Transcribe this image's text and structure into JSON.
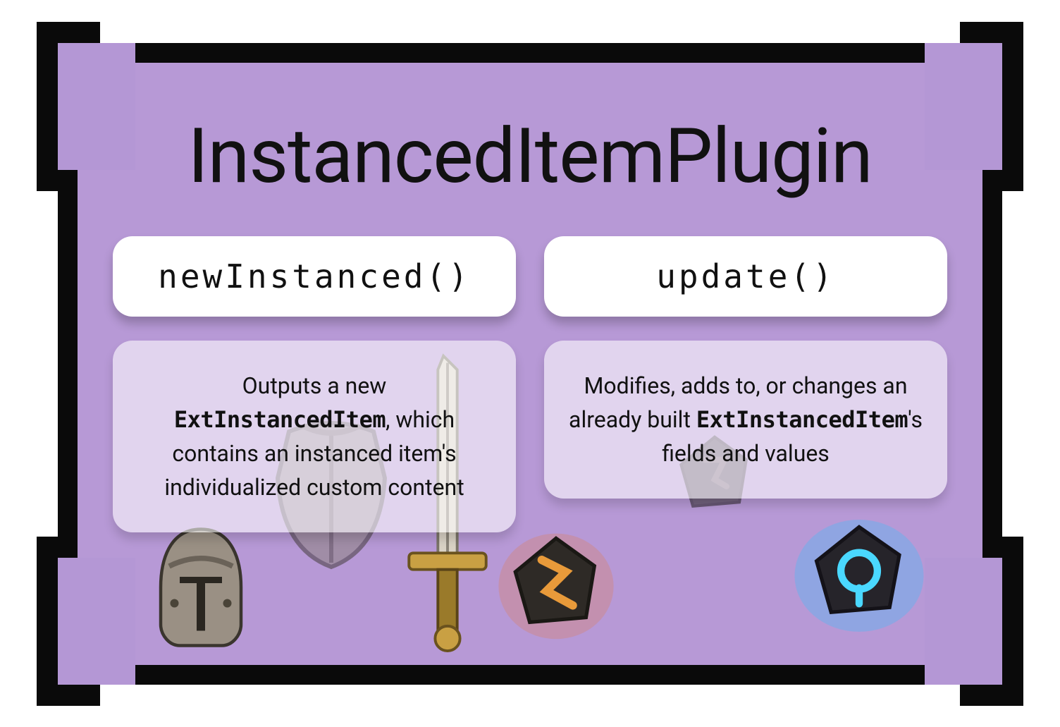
{
  "title": "InstancedItemPlugin",
  "methods": [
    {
      "name": "newInstanced()",
      "description_pre": "Outputs a new ",
      "description_code": "ExtInstancedItem",
      "description_post": ", which contains an instanced item's individualized custom content"
    },
    {
      "name": "update()",
      "description_pre": "Modifies, adds to, or changes an already built ",
      "description_code": "ExtInstancedItem",
      "description_post": "'s fields and values"
    }
  ],
  "icons": {
    "helmet": "helmet-icon",
    "armor": "armor-icon",
    "sword": "sword-icon",
    "rune_orange": "rune-orange-icon",
    "rune_dark": "rune-dark-icon",
    "rune_blue": "rune-blue-icon"
  }
}
